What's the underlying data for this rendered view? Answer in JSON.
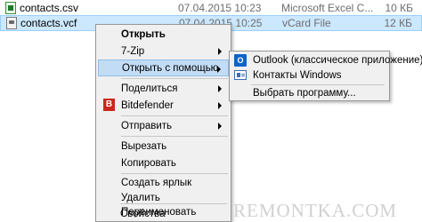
{
  "files": [
    {
      "name": "contacts.csv",
      "date": "07.04.2015 10:23",
      "type": "Microsoft Excel C...",
      "size": "10 КБ",
      "icon": "csv-file-icon"
    },
    {
      "name": "contacts.vcf",
      "date": "07.04.2015 10:25",
      "type": "vCard File",
      "size": "12 КБ",
      "icon": "vcf-file-icon"
    }
  ],
  "context_menu": {
    "items": [
      {
        "label": "Открыть"
      },
      {
        "label": "7-Zip"
      },
      {
        "label": "Открыть с помощью"
      },
      {
        "label": "Поделиться"
      },
      {
        "label": "Bitdefender"
      },
      {
        "label": "Отправить"
      },
      {
        "label": "Вырезать"
      },
      {
        "label": "Копировать"
      },
      {
        "label": "Создать ярлык"
      },
      {
        "label": "Удалить"
      },
      {
        "label": "Переименовать"
      },
      {
        "label": "Свойства"
      }
    ]
  },
  "submenu": {
    "items": [
      {
        "label": "Outlook (классическое приложение)",
        "icon": "outlook-icon"
      },
      {
        "label": "Контакты Windows",
        "icon": "windows-contacts-icon"
      },
      {
        "label": "Выбрать программу..."
      }
    ]
  },
  "watermark": "REMONTKA.COM",
  "colors": {
    "selected_row": "#cce8ff",
    "hover_item": "#c3dcf5",
    "bitdefender": "#c8281e",
    "outlook": "#0a64c8"
  }
}
